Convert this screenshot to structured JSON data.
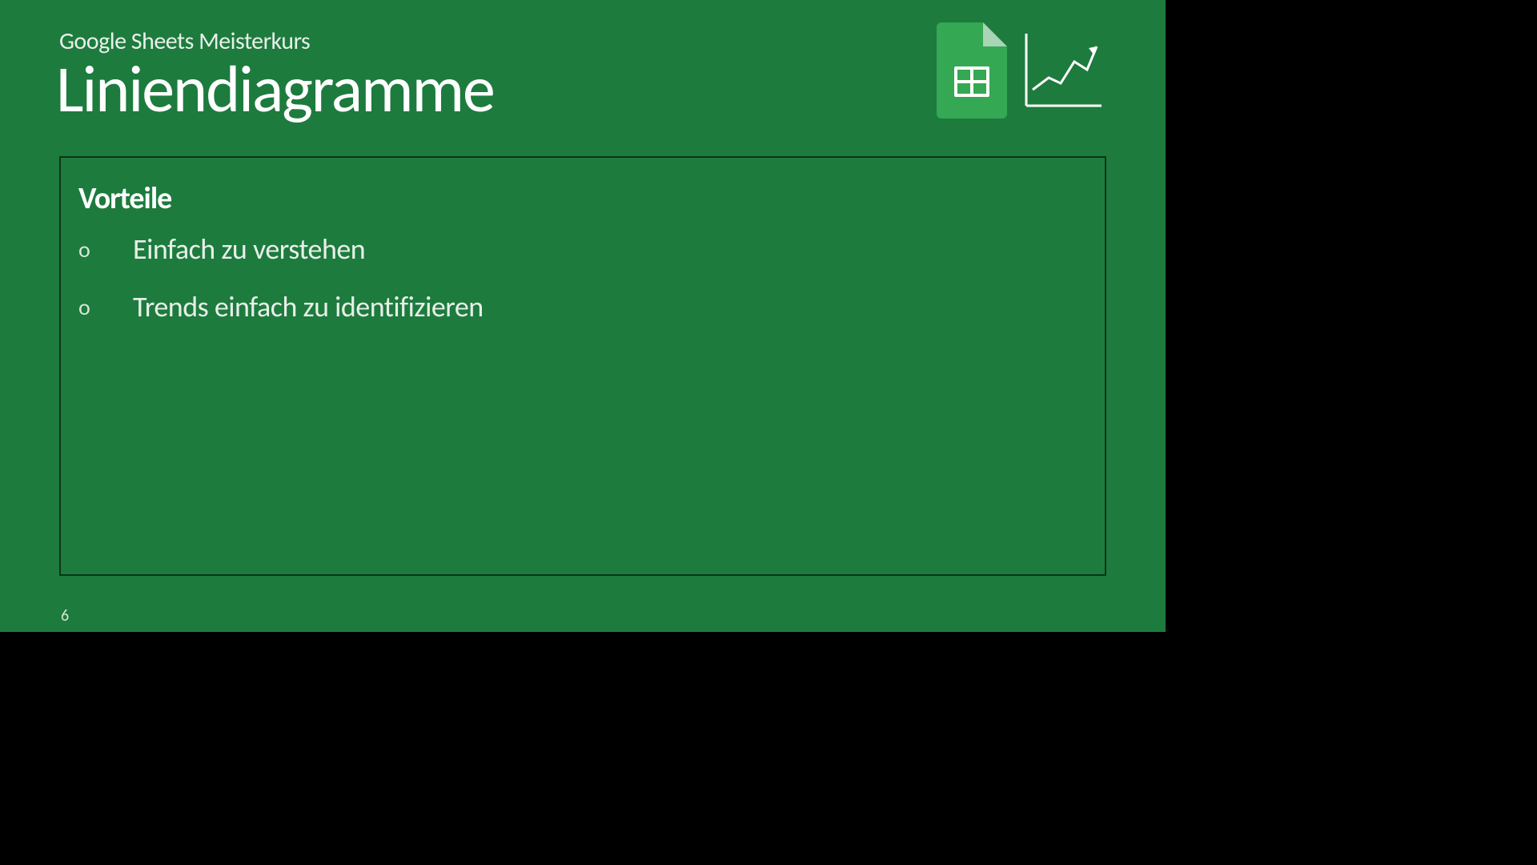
{
  "header": {
    "subtitle": "Google Sheets Meisterkurs",
    "title": "Liniendiagramme"
  },
  "content": {
    "heading": "Vorteile",
    "bullets": [
      "Einfach zu verstehen",
      "Trends einfach zu identifizieren"
    ]
  },
  "footer": {
    "page_number": "6"
  },
  "icons": {
    "sheets": "google-sheets-icon",
    "chart": "line-chart-icon"
  }
}
